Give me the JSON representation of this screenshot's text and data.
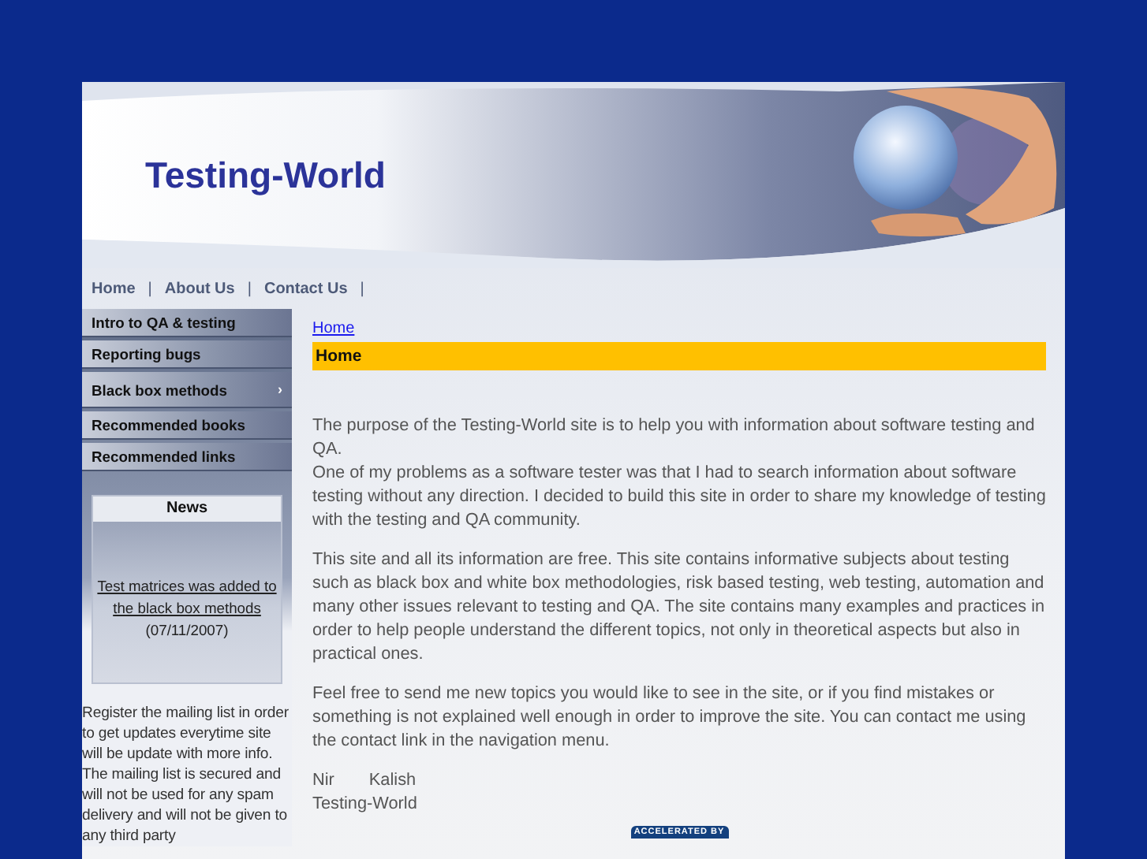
{
  "header": {
    "title": "Testing-World"
  },
  "nav": [
    {
      "label": "Home",
      "separator": "|"
    },
    {
      "label": "About Us",
      "separator": "|"
    },
    {
      "label": "Contact Us",
      "separator": "|"
    }
  ],
  "menu": [
    {
      "label": "Intro to QA & testing"
    },
    {
      "label": "Reporting bugs"
    },
    {
      "label": "Black box methods",
      "marker": "›"
    },
    {
      "label": "Recommended books"
    },
    {
      "label": "Recommended links"
    }
  ],
  "news": {
    "title": "News",
    "link": "Test matrices was added to the black box methods",
    "date": "(07/11/2007)"
  },
  "mailing_note": "Register the mailing list in order to get updates everytime site will be update with more info. The mailing list is secured and will not be used for any spam delivery and will not be given to any third party",
  "breadcrumb": "Home",
  "page_heading": "Home",
  "paragraphs": [
    [
      "The purpose of the Testing-World site is to help you with information about software testing and QA.",
      "One of my problems as a software tester was that I had to search information about software testing without any direction. I decided to build this site in order to share my knowledge of testing with the testing and QA community."
    ],
    [
      "This site and all its information are free. This site contains informative subjects about testing such as black box and white box methodologies, risk based testing, web testing, automation and many other issues relevant to testing and QA. The site contains many examples and practices in order to help people understand the different topics, not only in theoretical aspects but also in practical ones."
    ],
    [
      "Feel free to send me new topics you would like to see in the site, or if you find mistakes or something is not explained well enough in order to improve the site. You can contact me using the contact link in the navigation menu."
    ]
  ],
  "signature": [
    [
      "Nir",
      "Kalish"
    ],
    [
      "Testing-World"
    ]
  ],
  "badge": "ACCELERATED BY"
}
